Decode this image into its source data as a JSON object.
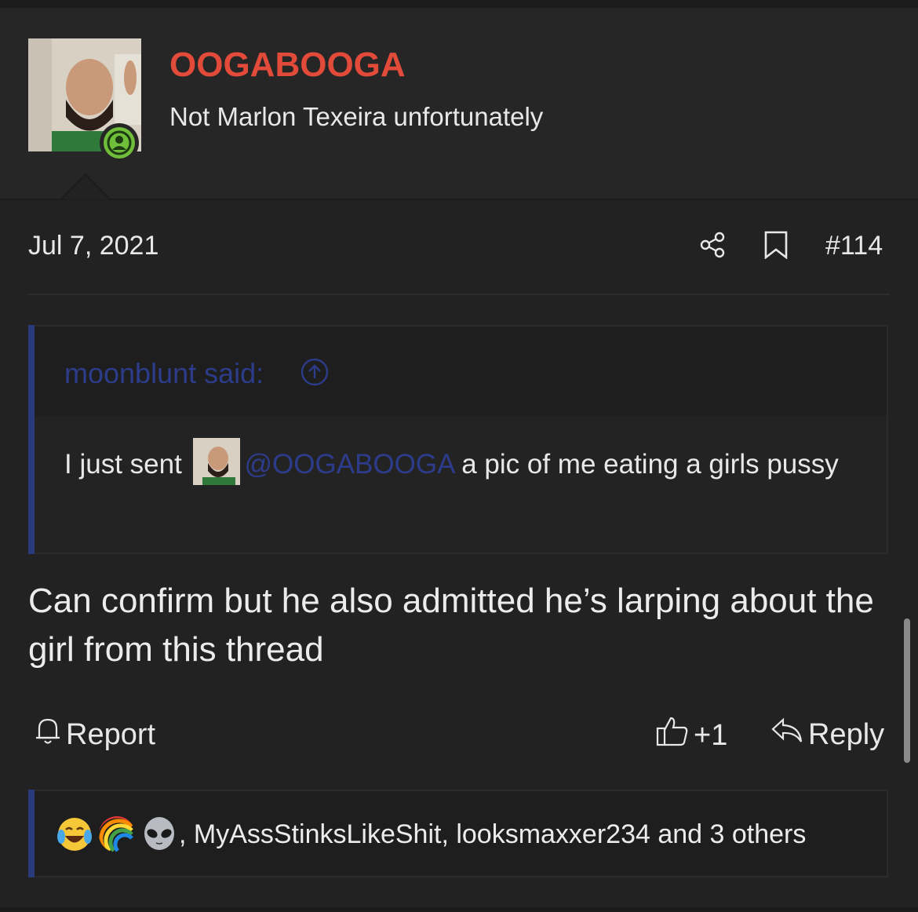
{
  "user": {
    "name": "OOGABOOGA",
    "title": "Not Marlon Texeira unfortunately"
  },
  "post": {
    "date": "Jul 7, 2021",
    "number": "#114",
    "text": "Can confirm but he also admitted he’s larping about the girl from this thread"
  },
  "quote": {
    "author": "moonblunt said:",
    "text_before": "I just sent ",
    "mention": "@OOGABOOGA",
    "text_after": " a pic of me eating a girls pussy"
  },
  "actions": {
    "report": "Report",
    "like_count": "+1",
    "reply": "Reply"
  },
  "reactions": {
    "text": ", MyAssStinksLikeShit, looksmaxxer234 and 3 others",
    "emojis": [
      "laughing-crying-emoji",
      "rainbow-emoji",
      "alien-emoji"
    ]
  },
  "colors": {
    "username": "#e24b3a",
    "mention": "#2d3c8a",
    "quote_bar": "#2b3a7a",
    "online": "#6fbf3a"
  }
}
